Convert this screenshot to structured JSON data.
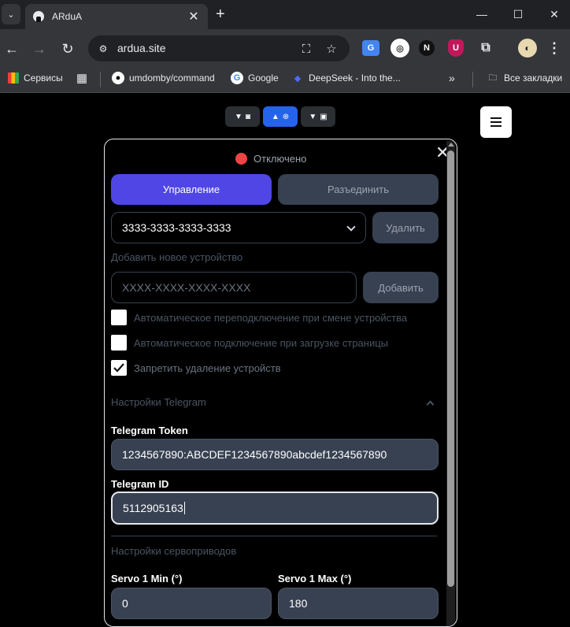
{
  "browser": {
    "tab_title": "ARduA",
    "url": "ardua.site",
    "bookmarks": [
      {
        "label": "Сервисы"
      },
      {
        "label": "umdomby/command"
      },
      {
        "label": "Google"
      },
      {
        "label": "DeepSeek - Into the..."
      },
      {
        "label": "Все закладки"
      }
    ],
    "extensions": [
      "N",
      "U"
    ]
  },
  "app": {
    "status": "Отключено",
    "status_color": "#ef4444",
    "control_button": "Управление",
    "disconnect_button": "Разъединить",
    "selected_device": "3333-3333-3333-3333",
    "delete_button": "Удалить",
    "add_device_label": "Добавить новое устройство",
    "new_device_placeholder": "XXXX-XXXX-XXXX-XXXX",
    "add_button": "Добавить",
    "checkboxes": [
      {
        "label": "Автоматическое переподключение при смене устройства",
        "checked": false
      },
      {
        "label": "Автоматическое подключение при загрузке страницы",
        "checked": false
      },
      {
        "label": "Запретить удаление устройств",
        "checked": true
      }
    ],
    "telegram_section": "Настройки Telegram",
    "telegram_token_label": "Telegram Token",
    "telegram_token_value": "1234567890:ABCDEF1234567890abcdef1234567890",
    "telegram_id_label": "Telegram ID",
    "telegram_id_value": "5112905163",
    "servo_section": "Настройки сервоприводов",
    "servo1_min_label": "Servo 1 Min (°)",
    "servo1_min_value": "0",
    "servo1_max_label": "Servo 1 Max (°)",
    "servo1_max_value": "180",
    "accent_color": "#4f46e5"
  }
}
